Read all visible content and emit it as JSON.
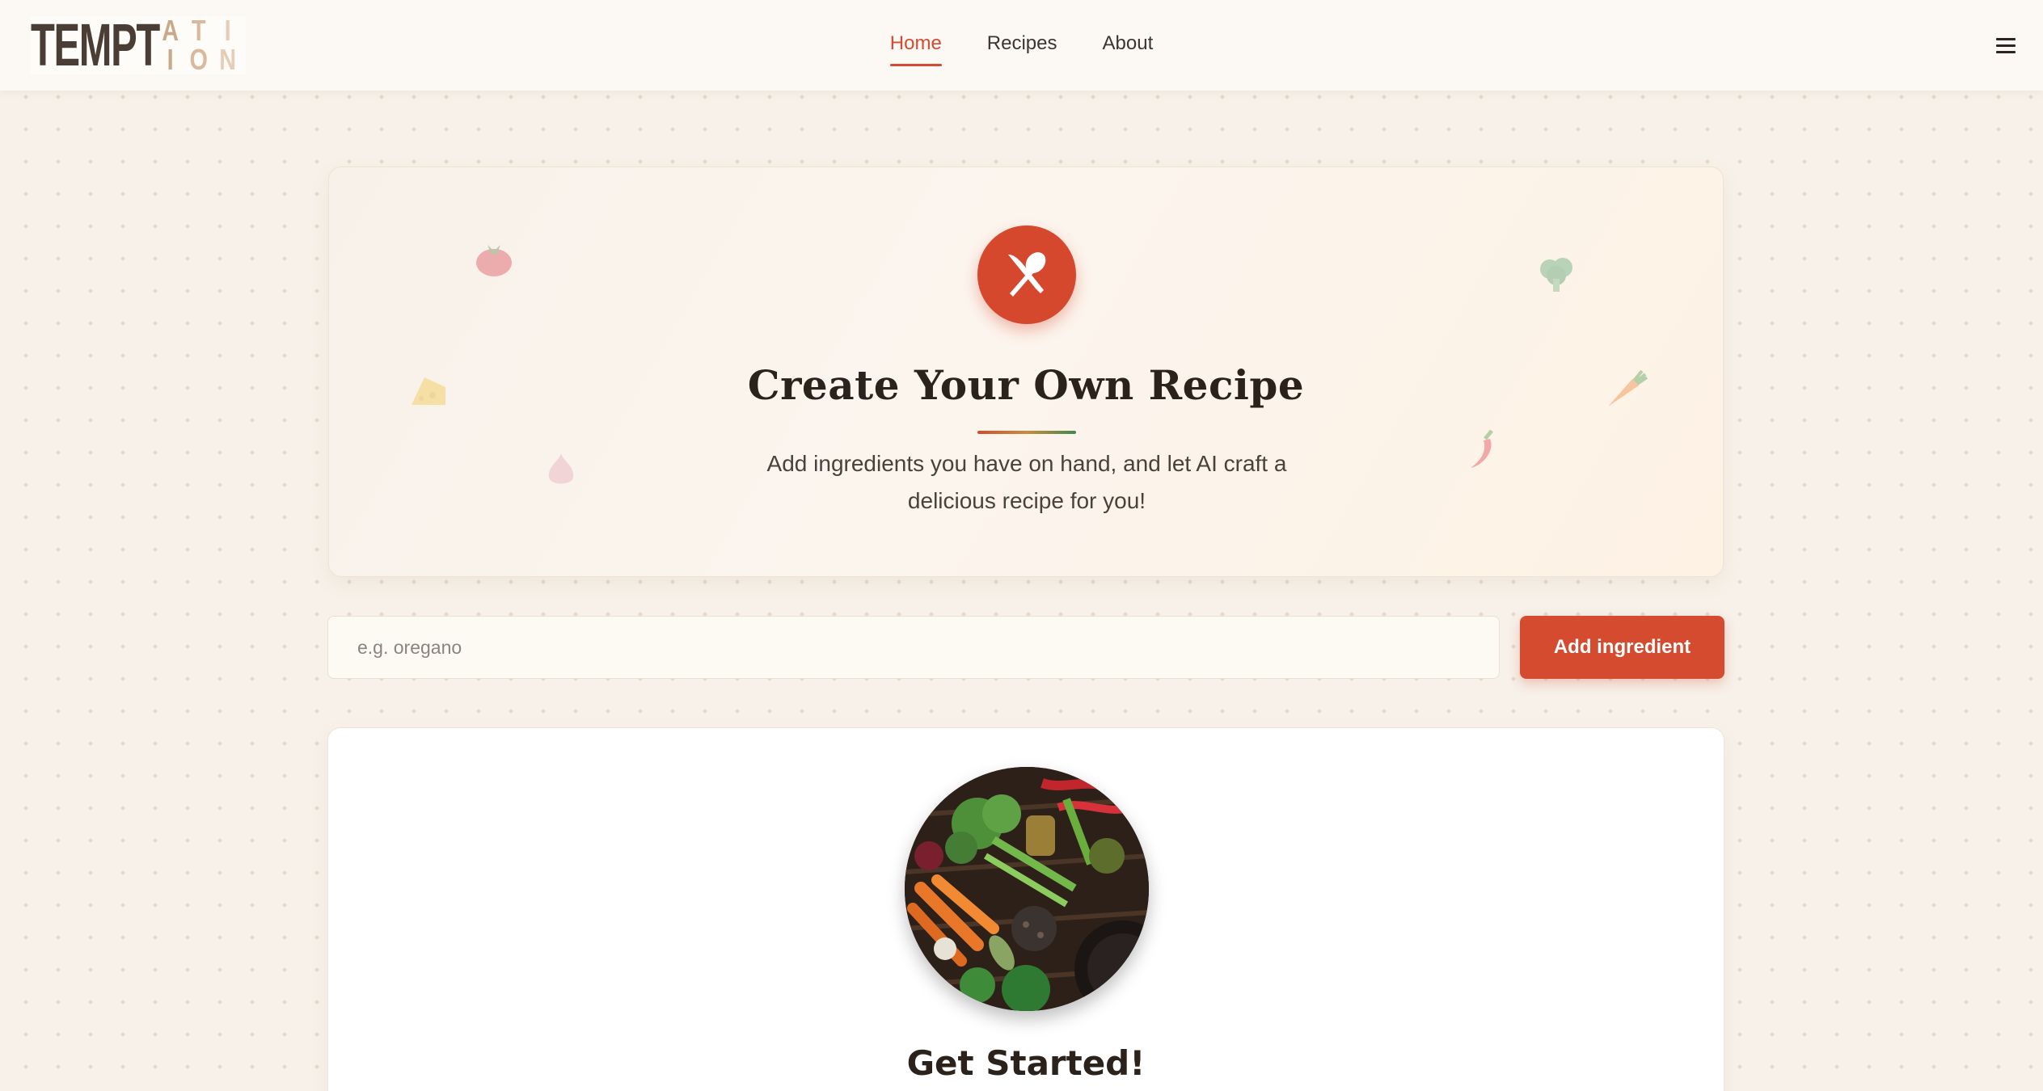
{
  "logo": {
    "word": "TEMPT",
    "grid": [
      "A",
      "T",
      "I",
      "I",
      "O",
      "N"
    ]
  },
  "nav": {
    "items": [
      "Home",
      "Recipes",
      "About"
    ],
    "active": "Home"
  },
  "hero": {
    "title": "Create Your Own Recipe",
    "subtitle": "Add ingredients you have on hand, and let AI craft a delicious recipe for you!"
  },
  "ingredient_input": {
    "value": "",
    "placeholder": "e.g. oregano"
  },
  "add_button": {
    "label": "Add ingredient"
  },
  "start": {
    "title": "Get Started!"
  },
  "colors": {
    "accent": "#d54b30",
    "background": "#f7f1e9",
    "card": "#ffffff"
  }
}
